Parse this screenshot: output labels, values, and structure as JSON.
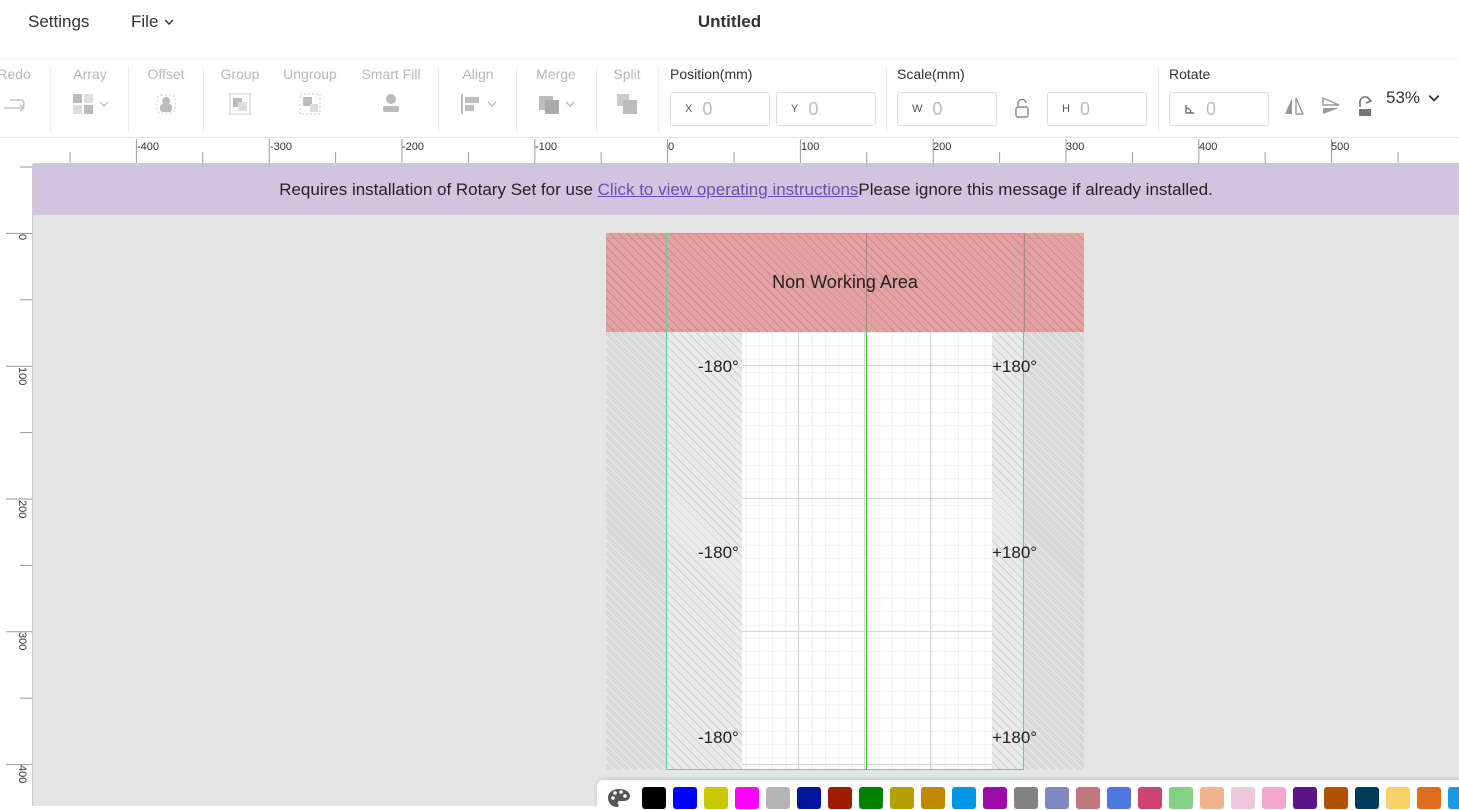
{
  "menu": {
    "settings": "Settings",
    "file": "File"
  },
  "document": {
    "title": "Untitled"
  },
  "toolbar": {
    "redo": "Redo",
    "array": "Array",
    "offset": "Offset",
    "group": "Group",
    "ungroup": "Ungroup",
    "smart_fill": "Smart Fill",
    "align": "Align",
    "merge": "Merge",
    "split": "Split",
    "position_label": "Position(mm)",
    "position_x_prefix": "X",
    "position_x": "0",
    "position_y_prefix": "Y",
    "position_y": "0",
    "scale_label": "Scale(mm)",
    "scale_w_prefix": "W",
    "scale_w": "0",
    "scale_h_prefix": "H",
    "scale_h": "0",
    "rotate_label": "Rotate",
    "rotate_value": "0",
    "zoom": "53%"
  },
  "ruler": {
    "top_labels": [
      "-400",
      "-300",
      "-200",
      "-100",
      "0",
      "100",
      "200",
      "300",
      "400",
      "500"
    ],
    "left_labels": [
      "0",
      "100",
      "200",
      "300",
      "400"
    ]
  },
  "notice": {
    "text": "Requires installation of Rotary Set for use ",
    "link": "Click to view operating instructions",
    "suffix": "Please ignore this message if already installed."
  },
  "workarea": {
    "non_working": "Non Working Area",
    "deg_left": [
      "-180°",
      "-180°",
      "-180°"
    ],
    "deg_right": [
      "+180°",
      "+180°",
      "+180°"
    ]
  },
  "palette": {
    "colors": [
      "#000000",
      "#0000ff",
      "#c8c800",
      "#ff00ff",
      "#b4b4b4",
      "#00149c",
      "#a01c00",
      "#008000",
      "#b4a000",
      "#c08800",
      "#0096e6",
      "#9c0aaa",
      "#828282",
      "#8088c0",
      "#c07880",
      "#4e78e0",
      "#d04070",
      "#82d282",
      "#f0b48c",
      "#f0c8dc",
      "#f4a6cc",
      "#5a1488",
      "#b05000",
      "#003c5a",
      "#f8d264",
      "#e06c1c",
      "#1898e8"
    ]
  }
}
